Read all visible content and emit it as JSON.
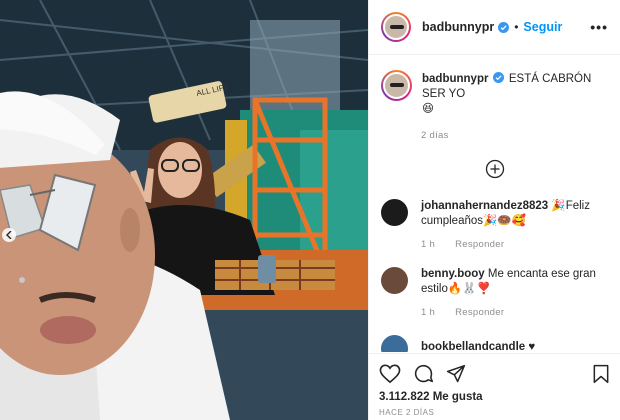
{
  "post": {
    "username": "badbunnypr",
    "follow_label": "Seguir",
    "more_label": "•••",
    "caption_user": "badbunnypr",
    "caption_text": "ESTÁ CABRÓN SER YO",
    "caption_emoji": "😆",
    "caption_time": "2 días"
  },
  "photo": {
    "sign_text": "ALL LIFT"
  },
  "comments": [
    {
      "user": "johannahernandez8823",
      "text": "🎉Feliz cumpleaños🎉🍩🥰",
      "time": "1 h",
      "reply": "Responder",
      "avatar_color": "#1b1b1b"
    },
    {
      "user": "benny.booy",
      "text": "Me encanta ese gran estilo🔥🐰❣️",
      "time": "1 h",
      "reply": "Responder",
      "avatar_color": "#6a4a3a"
    },
    {
      "user": "bookbellandcandle",
      "text": "♥",
      "time": "",
      "reply": "",
      "avatar_color": "#3b6d9a"
    }
  ],
  "footer": {
    "likes": "3.112.822 Me gusta",
    "date": "HACE 2 DÍAS"
  },
  "colors": {
    "accent": "#0095f6",
    "verified": "#3897f0",
    "muted": "#8e8e8e"
  }
}
